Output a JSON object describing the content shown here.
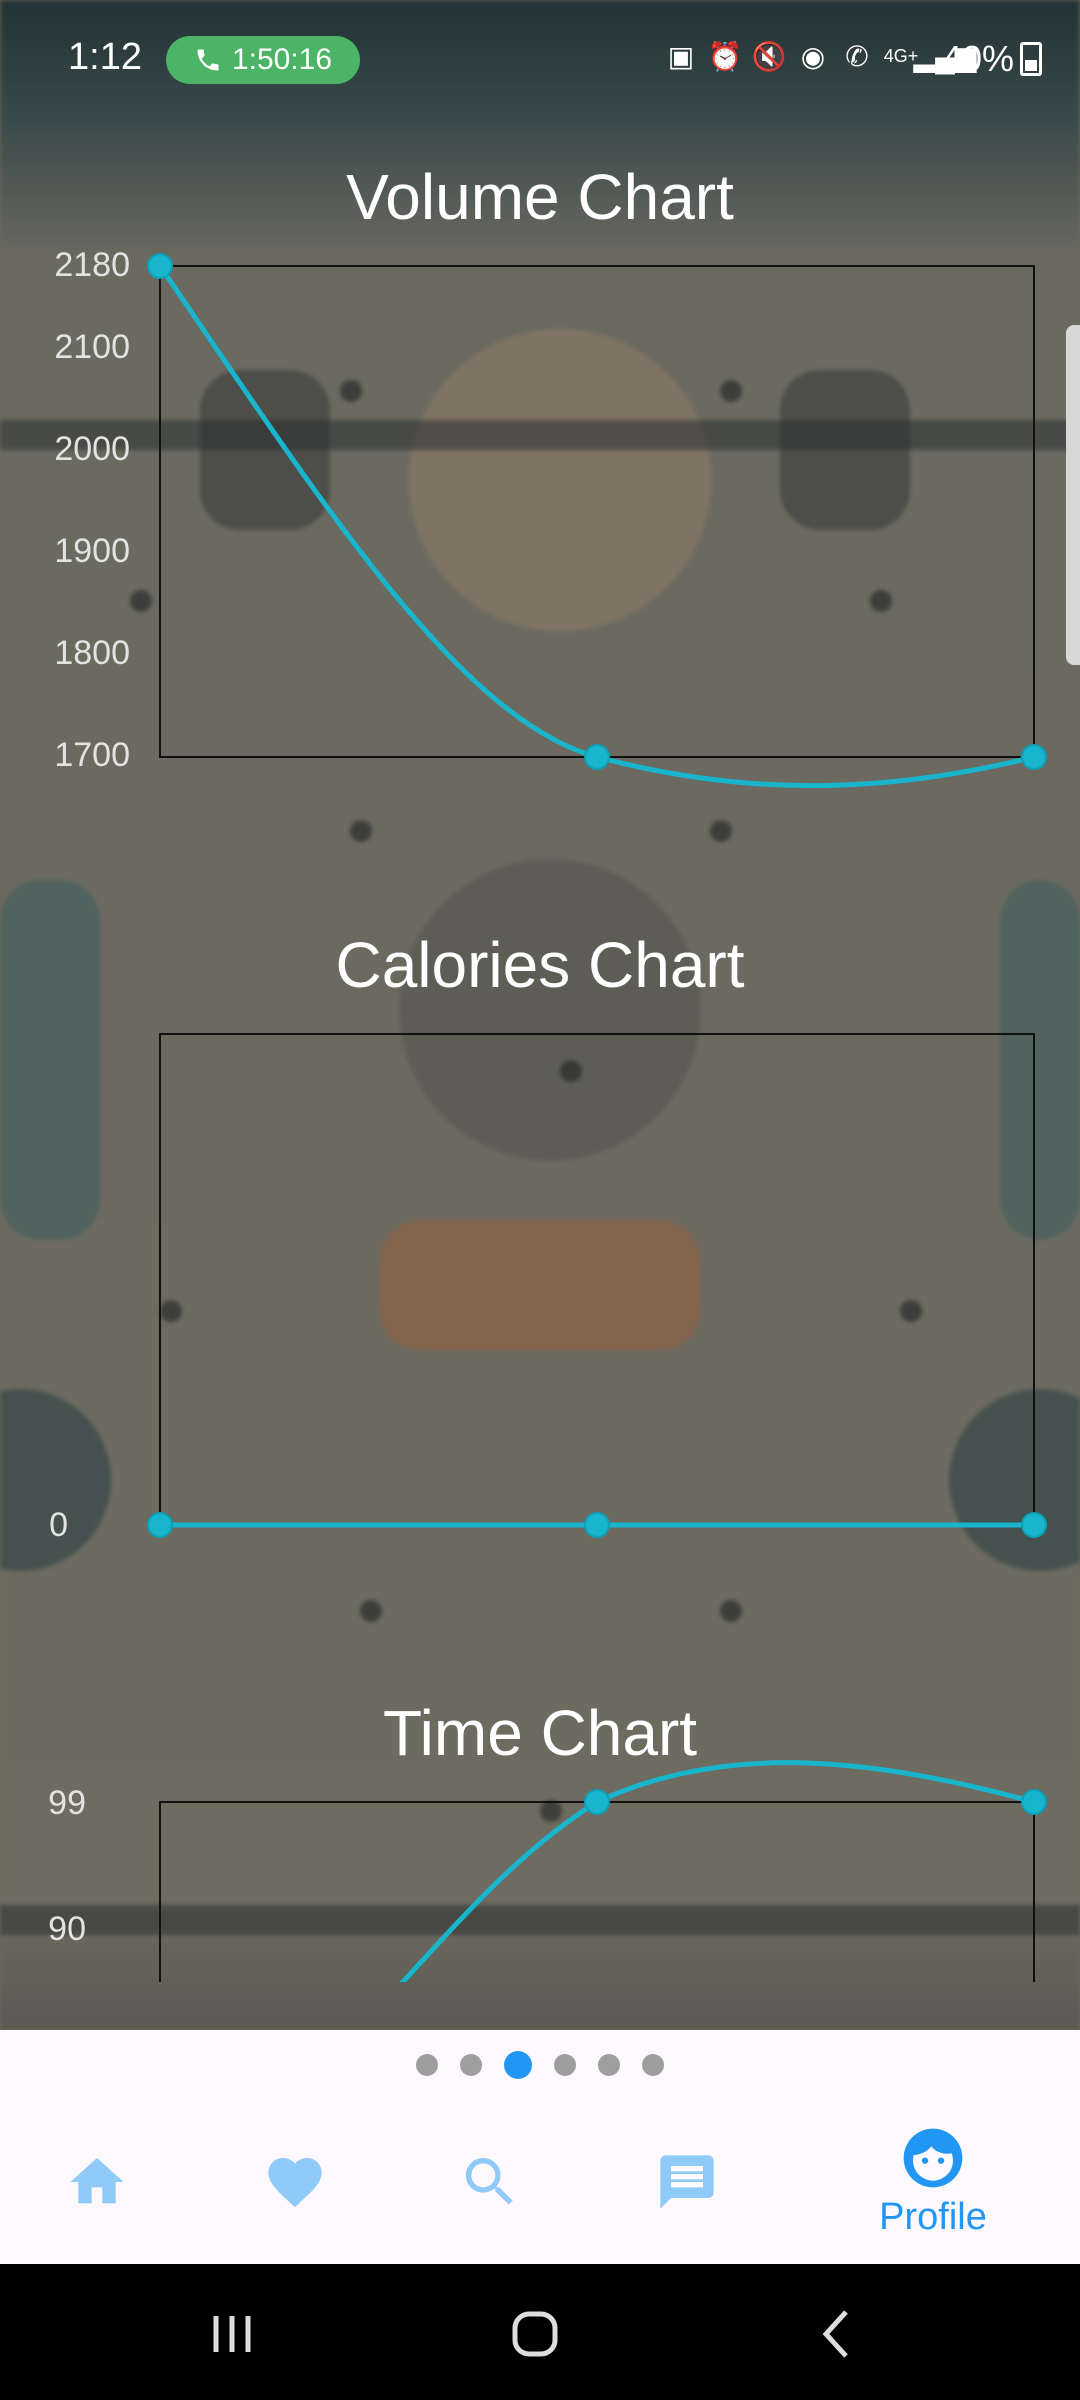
{
  "status_bar": {
    "time": "1:12",
    "call_timer": "1:50:16",
    "battery": "40%",
    "icons": [
      "battery-saver-icon",
      "alarm-icon",
      "mute-icon",
      "hotspot-icon",
      "wifi-call-icon",
      "4g-icon",
      "signal-icon"
    ]
  },
  "charts": {
    "volume": {
      "title": "Volume Chart",
      "ticks": [
        "2180",
        "2100",
        "2000",
        "1900",
        "1800",
        "1700"
      ]
    },
    "calories": {
      "title": "Calories Chart",
      "ticks": [
        "0"
      ]
    },
    "time": {
      "title": "Time Chart",
      "ticks": [
        "99",
        "90"
      ]
    }
  },
  "chart_data": [
    {
      "type": "line",
      "title": "Volume Chart",
      "x": [
        0,
        1,
        2
      ],
      "values": [
        2180,
        1700,
        1700
      ],
      "ylim": [
        1700,
        2180
      ],
      "color": "#18b5cc"
    },
    {
      "type": "line",
      "title": "Calories Chart",
      "x": [
        0,
        1,
        2
      ],
      "values": [
        0,
        0,
        0
      ],
      "color": "#18b5cc"
    },
    {
      "type": "line",
      "title": "Time Chart",
      "x": [
        0,
        1,
        2
      ],
      "values": [
        99,
        99
      ],
      "color": "#18b5cc"
    }
  ],
  "pager": {
    "count": 6,
    "active_index": 2
  },
  "nav": {
    "items": [
      {
        "name": "home",
        "icon": "home-icon"
      },
      {
        "name": "favorites",
        "icon": "heart-icon"
      },
      {
        "name": "search",
        "icon": "search-icon"
      },
      {
        "name": "messages",
        "icon": "message-icon"
      },
      {
        "name": "profile",
        "icon": "face-icon",
        "label": "Profile"
      }
    ],
    "profile_label": "Profile"
  },
  "colors": {
    "accent": "#2196f3",
    "line": "#18b5cc",
    "nav_icon": "#90caf9"
  }
}
